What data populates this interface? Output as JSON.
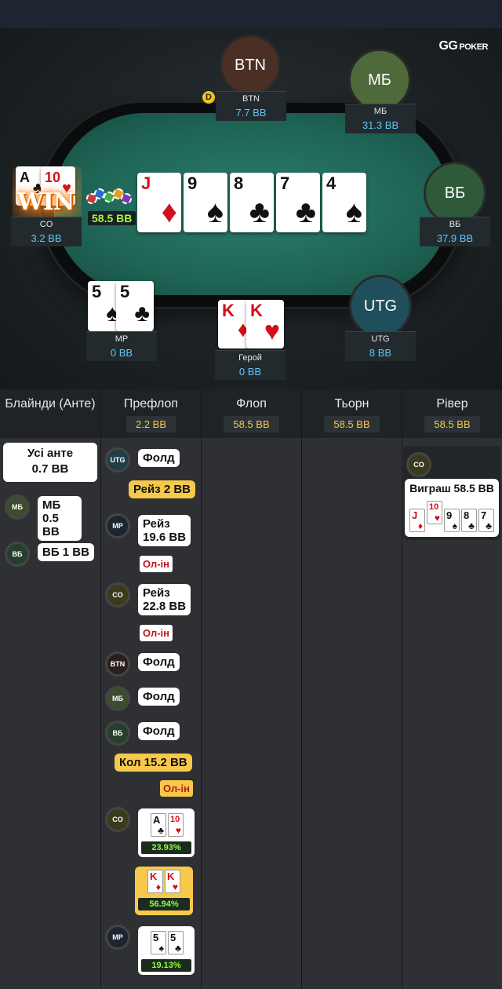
{
  "app": {
    "logo_text": "GG",
    "logo_sub": "POKER"
  },
  "table": {
    "pot": "58.5 BB",
    "dealer": "D",
    "win_label": "WIN",
    "board": [
      {
        "rank": "J",
        "suit": "♦",
        "color": "red"
      },
      {
        "rank": "9",
        "suit": "♠",
        "color": "black"
      },
      {
        "rank": "8",
        "suit": "♣",
        "color": "black"
      },
      {
        "rank": "7",
        "suit": "♣",
        "color": "black"
      },
      {
        "rank": "4",
        "suit": "♠",
        "color": "black"
      }
    ],
    "seats": {
      "btn": {
        "avatar": "BTN",
        "name": "BTN",
        "stack": "7.7 BB"
      },
      "mb": {
        "avatar": "МБ",
        "name": "МБ",
        "stack": "31.3 BB"
      },
      "vb": {
        "avatar": "ВБ",
        "name": "ВБ",
        "stack": "37.9 BB"
      },
      "utg": {
        "avatar": "UTG",
        "name": "UTG",
        "stack": "8 BB"
      },
      "hero": {
        "name": "Герой",
        "stack": "0 BB",
        "cards": [
          {
            "rank": "K",
            "suit": "♦"
          },
          {
            "rank": "K",
            "suit": "♥"
          }
        ]
      },
      "mp": {
        "name": "MP",
        "stack": "0 BB",
        "cards": [
          {
            "rank": "5",
            "suit": "♠"
          },
          {
            "rank": "5",
            "suit": "♣"
          }
        ]
      },
      "co": {
        "name": "CO",
        "stack": "3.2 BB",
        "cards": [
          {
            "rank": "A",
            "suit": "♣"
          },
          {
            "rank": "10",
            "suit": "♥"
          }
        ]
      }
    }
  },
  "streets": [
    {
      "title": "Блайнди (Анте)",
      "pot": ""
    },
    {
      "title": "Префлоп",
      "pot": "2.2 BB"
    },
    {
      "title": "Флоп",
      "pot": "58.5 BB"
    },
    {
      "title": "Тьорн",
      "pot": "58.5 BB"
    },
    {
      "title": "Рівер",
      "pot": "58.5 BB"
    }
  ],
  "blinds": {
    "ante_line1": "Усі анте",
    "ante_line2": "0.7 BB",
    "mb_pos": "МБ",
    "mb_line1": "МБ",
    "mb_line2": "0.5 BB",
    "vb_pos": "ВБ",
    "vb_text": "ВБ 1 BB"
  },
  "preflop": {
    "utg_pos": "UTG",
    "utg_action": "Фолд",
    "hero_raise": "Рейз 2 BB",
    "mp_pos": "MP",
    "mp_action1": "Рейз",
    "mp_action2": "19.6 BB",
    "mp_allin": "Ол-ін",
    "co_pos": "CO",
    "co_action1": "Рейз",
    "co_action2": "22.8 BB",
    "co_allin": "Ол-ін",
    "btn_pos": "BTN",
    "btn_action": "Фолд",
    "mb_pos": "МБ",
    "mb_action": "Фолд",
    "vb_pos": "ВБ",
    "vb_action": "Фолд",
    "hero_call": "Кол 15.2 BB",
    "hero_allin": "Ол-ін",
    "co_show_pos": "CO",
    "co_equity": "23.93%",
    "hero_equity": "56.94%",
    "mp_show_pos": "MP",
    "mp_equity": "19.13%"
  },
  "river": {
    "co_pos": "CO",
    "win_text": "Виграш 58.5 BB"
  }
}
